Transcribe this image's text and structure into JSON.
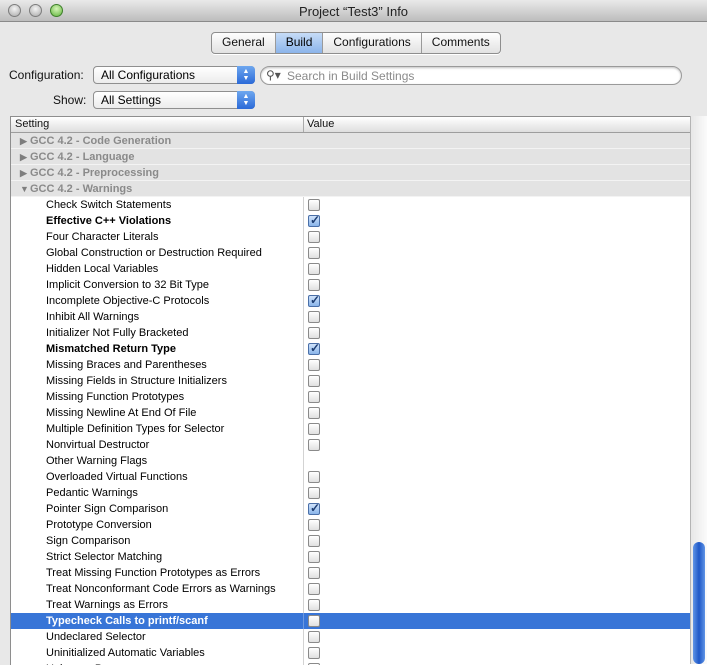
{
  "window": {
    "title": "Project “Test3” Info"
  },
  "tabs": [
    {
      "label": "General"
    },
    {
      "label": "Build"
    },
    {
      "label": "Configurations"
    },
    {
      "label": "Comments"
    }
  ],
  "selected_tab": "Build",
  "configuration": {
    "label": "Configuration:",
    "value": "All Configurations"
  },
  "show": {
    "label": "Show:",
    "value": "All Settings"
  },
  "search": {
    "placeholder": "Search in Build Settings"
  },
  "table": {
    "col_setting": "Setting",
    "col_value": "Value"
  },
  "groups": [
    {
      "name": "GCC 4.2 - Code Generation",
      "expanded": false
    },
    {
      "name": "GCC 4.2 - Language",
      "expanded": false
    },
    {
      "name": "GCC 4.2 - Preprocessing",
      "expanded": false
    },
    {
      "name": "GCC 4.2 - Warnings",
      "expanded": true
    }
  ],
  "settings": [
    {
      "name": "Check Switch Statements",
      "bold": false,
      "checkbox": true,
      "checked": false
    },
    {
      "name": "Effective C++ Violations",
      "bold": true,
      "checkbox": true,
      "checked": true
    },
    {
      "name": "Four Character Literals",
      "bold": false,
      "checkbox": true,
      "checked": false
    },
    {
      "name": "Global Construction or Destruction Required",
      "bold": false,
      "checkbox": true,
      "checked": false
    },
    {
      "name": "Hidden Local Variables",
      "bold": false,
      "checkbox": true,
      "checked": false
    },
    {
      "name": "Implicit Conversion to 32 Bit Type",
      "bold": false,
      "checkbox": true,
      "checked": false
    },
    {
      "name": "Incomplete Objective-C Protocols",
      "bold": false,
      "checkbox": true,
      "checked": true
    },
    {
      "name": "Inhibit All Warnings",
      "bold": false,
      "checkbox": true,
      "checked": false
    },
    {
      "name": "Initializer Not Fully Bracketed",
      "bold": false,
      "checkbox": true,
      "checked": false
    },
    {
      "name": "Mismatched Return Type",
      "bold": true,
      "checkbox": true,
      "checked": true
    },
    {
      "name": "Missing Braces and Parentheses",
      "bold": false,
      "checkbox": true,
      "checked": false
    },
    {
      "name": "Missing Fields in Structure Initializers",
      "bold": false,
      "checkbox": true,
      "checked": false
    },
    {
      "name": "Missing Function Prototypes",
      "bold": false,
      "checkbox": true,
      "checked": false
    },
    {
      "name": "Missing Newline At End Of File",
      "bold": false,
      "checkbox": true,
      "checked": false
    },
    {
      "name": "Multiple Definition Types for Selector",
      "bold": false,
      "checkbox": true,
      "checked": false
    },
    {
      "name": "Nonvirtual Destructor",
      "bold": false,
      "checkbox": true,
      "checked": false
    },
    {
      "name": "Other Warning Flags",
      "bold": false,
      "checkbox": false,
      "checked": false
    },
    {
      "name": "Overloaded Virtual Functions",
      "bold": false,
      "checkbox": true,
      "checked": false
    },
    {
      "name": "Pedantic Warnings",
      "bold": false,
      "checkbox": true,
      "checked": false
    },
    {
      "name": "Pointer Sign Comparison",
      "bold": false,
      "checkbox": true,
      "checked": true
    },
    {
      "name": "Prototype Conversion",
      "bold": false,
      "checkbox": true,
      "checked": false
    },
    {
      "name": "Sign Comparison",
      "bold": false,
      "checkbox": true,
      "checked": false
    },
    {
      "name": "Strict Selector Matching",
      "bold": false,
      "checkbox": true,
      "checked": false
    },
    {
      "name": "Treat Missing Function Prototypes as Errors",
      "bold": false,
      "checkbox": true,
      "checked": false
    },
    {
      "name": "Treat Nonconformant Code Errors as Warnings",
      "bold": false,
      "checkbox": true,
      "checked": false
    },
    {
      "name": "Treat Warnings as Errors",
      "bold": false,
      "checkbox": true,
      "checked": false
    },
    {
      "name": "Typecheck Calls to printf/scanf",
      "bold": true,
      "checkbox": true,
      "checked": false,
      "selected": true
    },
    {
      "name": "Undeclared Selector",
      "bold": false,
      "checkbox": true,
      "checked": false
    },
    {
      "name": "Uninitialized Automatic Variables",
      "bold": false,
      "checkbox": true,
      "checked": false
    },
    {
      "name": "Unknown Pragma",
      "bold": false,
      "checkbox": true,
      "checked": false
    }
  ],
  "colors": {
    "selection": "#3875d7",
    "accent": "#2b6ad8"
  }
}
